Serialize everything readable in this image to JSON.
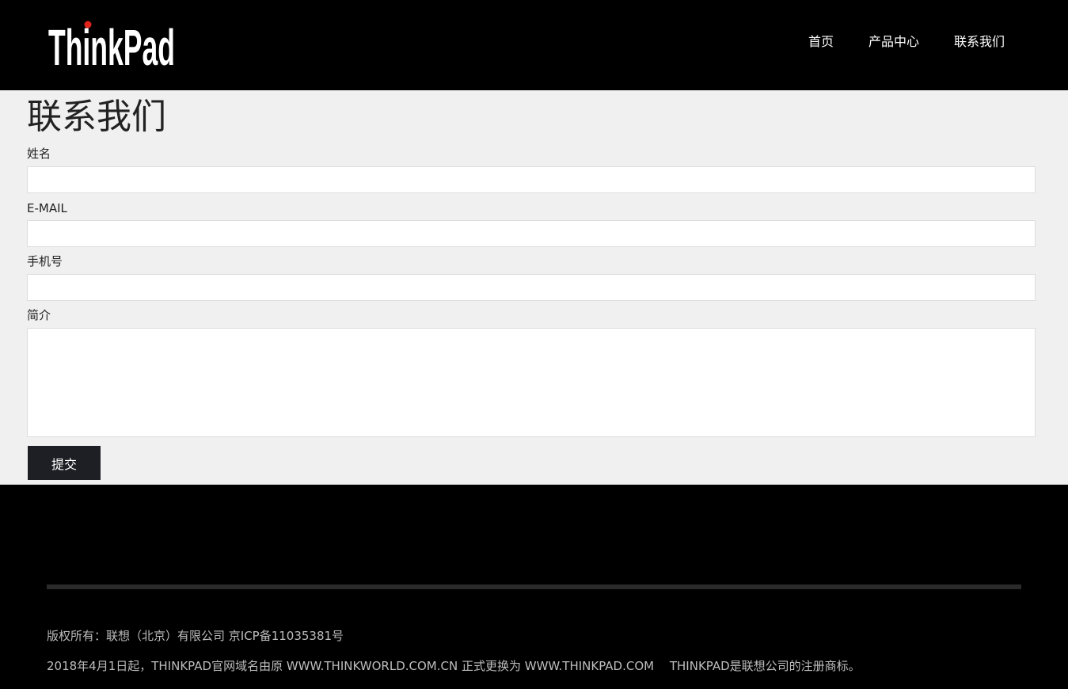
{
  "header": {
    "logo_text": "ThinkPad",
    "logo_dot_color": "#e2231a",
    "nav": [
      {
        "label": "首页"
      },
      {
        "label": "产品中心"
      },
      {
        "label": "联系我们"
      }
    ]
  },
  "main": {
    "title": "联系我们",
    "fields": {
      "name": {
        "label": "姓名",
        "value": ""
      },
      "email": {
        "label": "E-MAIL",
        "value": ""
      },
      "phone": {
        "label": "手机号",
        "value": ""
      },
      "intro": {
        "label": "简介",
        "value": ""
      }
    },
    "submit_label": "提交"
  },
  "footer": {
    "copyright": "版权所有：联想（北京）有限公司 京ICP备11035381号",
    "notice": "2018年4月1日起，THINKPAD官网域名由原 WWW.THINKWORLD.COM.CN 正式更换为 WWW.THINKPAD.COM　 THINKPAD是联想公司的注册商标。"
  }
}
